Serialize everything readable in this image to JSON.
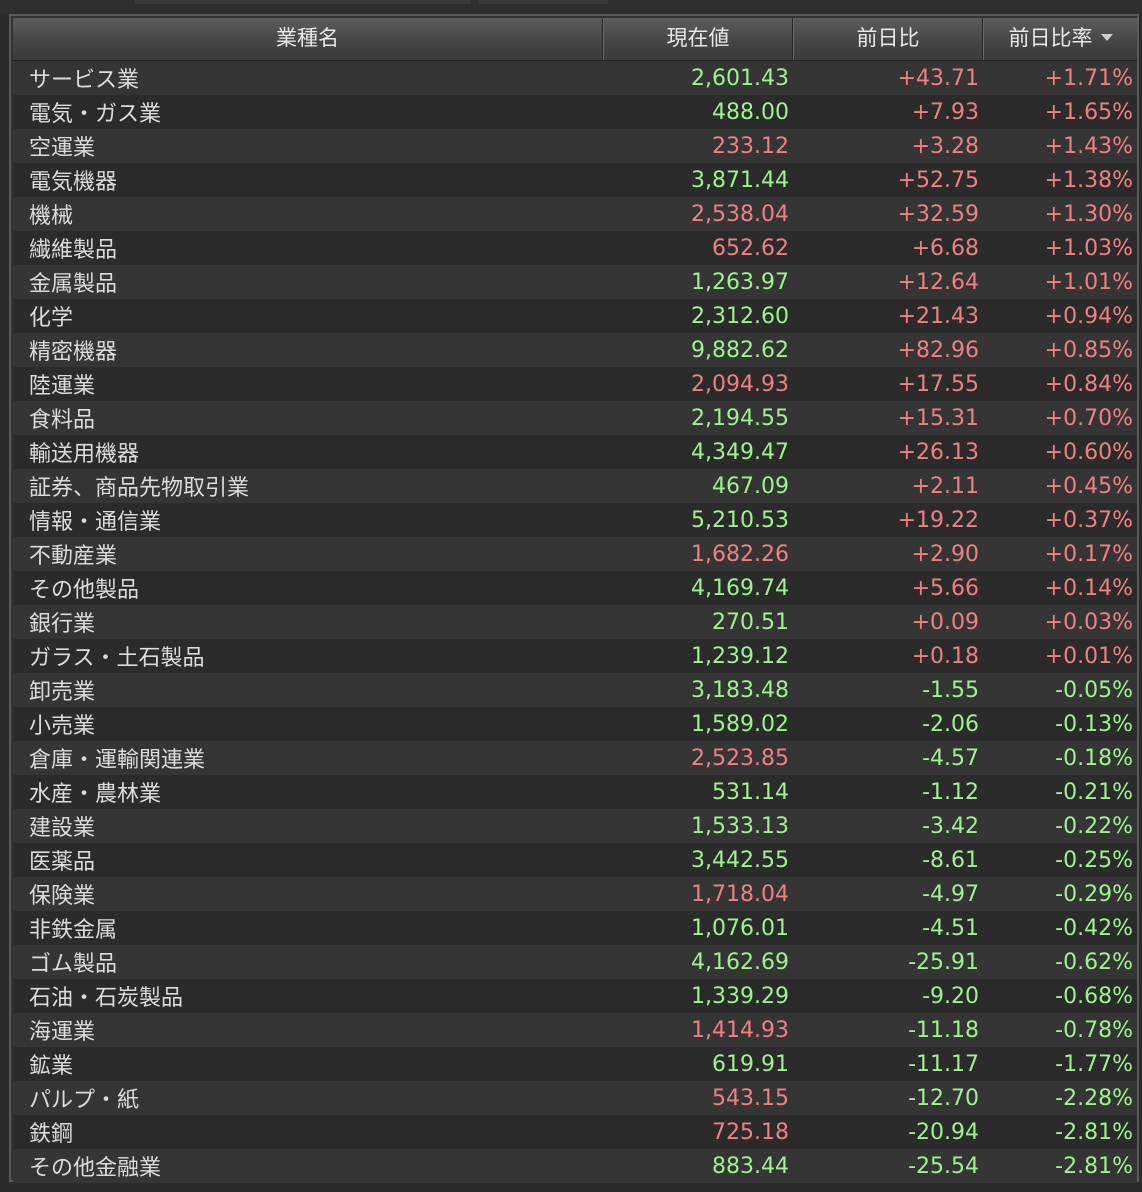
{
  "colors": {
    "up_green": "#9cf58c",
    "down_red": "#f08080",
    "text": "#dcdcdc",
    "row_alt": "#353535",
    "row_base": "#2b2b2b"
  },
  "table": {
    "headers": {
      "name": "業種名",
      "price": "現在値",
      "change": "前日比",
      "change_pct": "前日比率"
    },
    "sort_icon": "sort-descending-icon",
    "rows": [
      {
        "name": "サービス業",
        "price": "2,601.43",
        "price_color": "green",
        "change": "+43.71",
        "change_color": "red",
        "pct": "+1.71%",
        "pct_color": "red"
      },
      {
        "name": "電気・ガス業",
        "price": "488.00",
        "price_color": "green",
        "change": "+7.93",
        "change_color": "red",
        "pct": "+1.65%",
        "pct_color": "red"
      },
      {
        "name": "空運業",
        "price": "233.12",
        "price_color": "red",
        "change": "+3.28",
        "change_color": "red",
        "pct": "+1.43%",
        "pct_color": "red"
      },
      {
        "name": "電気機器",
        "price": "3,871.44",
        "price_color": "green",
        "change": "+52.75",
        "change_color": "red",
        "pct": "+1.38%",
        "pct_color": "red"
      },
      {
        "name": "機械",
        "price": "2,538.04",
        "price_color": "red",
        "change": "+32.59",
        "change_color": "red",
        "pct": "+1.30%",
        "pct_color": "red"
      },
      {
        "name": "繊維製品",
        "price": "652.62",
        "price_color": "red",
        "change": "+6.68",
        "change_color": "red",
        "pct": "+1.03%",
        "pct_color": "red"
      },
      {
        "name": "金属製品",
        "price": "1,263.97",
        "price_color": "green",
        "change": "+12.64",
        "change_color": "red",
        "pct": "+1.01%",
        "pct_color": "red"
      },
      {
        "name": "化学",
        "price": "2,312.60",
        "price_color": "green",
        "change": "+21.43",
        "change_color": "red",
        "pct": "+0.94%",
        "pct_color": "red"
      },
      {
        "name": "精密機器",
        "price": "9,882.62",
        "price_color": "green",
        "change": "+82.96",
        "change_color": "red",
        "pct": "+0.85%",
        "pct_color": "red"
      },
      {
        "name": "陸運業",
        "price": "2,094.93",
        "price_color": "red",
        "change": "+17.55",
        "change_color": "red",
        "pct": "+0.84%",
        "pct_color": "red"
      },
      {
        "name": "食料品",
        "price": "2,194.55",
        "price_color": "green",
        "change": "+15.31",
        "change_color": "red",
        "pct": "+0.70%",
        "pct_color": "red"
      },
      {
        "name": "輸送用機器",
        "price": "4,349.47",
        "price_color": "green",
        "change": "+26.13",
        "change_color": "red",
        "pct": "+0.60%",
        "pct_color": "red"
      },
      {
        "name": "証券、商品先物取引業",
        "price": "467.09",
        "price_color": "green",
        "change": "+2.11",
        "change_color": "red",
        "pct": "+0.45%",
        "pct_color": "red"
      },
      {
        "name": "情報・通信業",
        "price": "5,210.53",
        "price_color": "green",
        "change": "+19.22",
        "change_color": "red",
        "pct": "+0.37%",
        "pct_color": "red"
      },
      {
        "name": "不動産業",
        "price": "1,682.26",
        "price_color": "red",
        "change": "+2.90",
        "change_color": "red",
        "pct": "+0.17%",
        "pct_color": "red"
      },
      {
        "name": "その他製品",
        "price": "4,169.74",
        "price_color": "green",
        "change": "+5.66",
        "change_color": "red",
        "pct": "+0.14%",
        "pct_color": "red"
      },
      {
        "name": "銀行業",
        "price": "270.51",
        "price_color": "green",
        "change": "+0.09",
        "change_color": "red",
        "pct": "+0.03%",
        "pct_color": "red"
      },
      {
        "name": "ガラス・土石製品",
        "price": "1,239.12",
        "price_color": "green",
        "change": "+0.18",
        "change_color": "red",
        "pct": "+0.01%",
        "pct_color": "red"
      },
      {
        "name": "卸売業",
        "price": "3,183.48",
        "price_color": "green",
        "change": "-1.55",
        "change_color": "green",
        "pct": "-0.05%",
        "pct_color": "green"
      },
      {
        "name": "小売業",
        "price": "1,589.02",
        "price_color": "green",
        "change": "-2.06",
        "change_color": "green",
        "pct": "-0.13%",
        "pct_color": "green"
      },
      {
        "name": "倉庫・運輸関連業",
        "price": "2,523.85",
        "price_color": "red",
        "change": "-4.57",
        "change_color": "green",
        "pct": "-0.18%",
        "pct_color": "green"
      },
      {
        "name": "水産・農林業",
        "price": "531.14",
        "price_color": "green",
        "change": "-1.12",
        "change_color": "green",
        "pct": "-0.21%",
        "pct_color": "green"
      },
      {
        "name": "建設業",
        "price": "1,533.13",
        "price_color": "green",
        "change": "-3.42",
        "change_color": "green",
        "pct": "-0.22%",
        "pct_color": "green"
      },
      {
        "name": "医薬品",
        "price": "3,442.55",
        "price_color": "green",
        "change": "-8.61",
        "change_color": "green",
        "pct": "-0.25%",
        "pct_color": "green"
      },
      {
        "name": "保険業",
        "price": "1,718.04",
        "price_color": "red",
        "change": "-4.97",
        "change_color": "green",
        "pct": "-0.29%",
        "pct_color": "green"
      },
      {
        "name": "非鉄金属",
        "price": "1,076.01",
        "price_color": "green",
        "change": "-4.51",
        "change_color": "green",
        "pct": "-0.42%",
        "pct_color": "green"
      },
      {
        "name": "ゴム製品",
        "price": "4,162.69",
        "price_color": "green",
        "change": "-25.91",
        "change_color": "green",
        "pct": "-0.62%",
        "pct_color": "green"
      },
      {
        "name": "石油・石炭製品",
        "price": "1,339.29",
        "price_color": "green",
        "change": "-9.20",
        "change_color": "green",
        "pct": "-0.68%",
        "pct_color": "green"
      },
      {
        "name": "海運業",
        "price": "1,414.93",
        "price_color": "red",
        "change": "-11.18",
        "change_color": "green",
        "pct": "-0.78%",
        "pct_color": "green"
      },
      {
        "name": "鉱業",
        "price": "619.91",
        "price_color": "green",
        "change": "-11.17",
        "change_color": "green",
        "pct": "-1.77%",
        "pct_color": "green"
      },
      {
        "name": "パルプ・紙",
        "price": "543.15",
        "price_color": "red",
        "change": "-12.70",
        "change_color": "green",
        "pct": "-2.28%",
        "pct_color": "green"
      },
      {
        "name": "鉄鋼",
        "price": "725.18",
        "price_color": "red",
        "change": "-20.94",
        "change_color": "green",
        "pct": "-2.81%",
        "pct_color": "green"
      },
      {
        "name": "その他金融業",
        "price": "883.44",
        "price_color": "green",
        "change": "-25.54",
        "change_color": "green",
        "pct": "-2.81%",
        "pct_color": "green"
      }
    ]
  }
}
